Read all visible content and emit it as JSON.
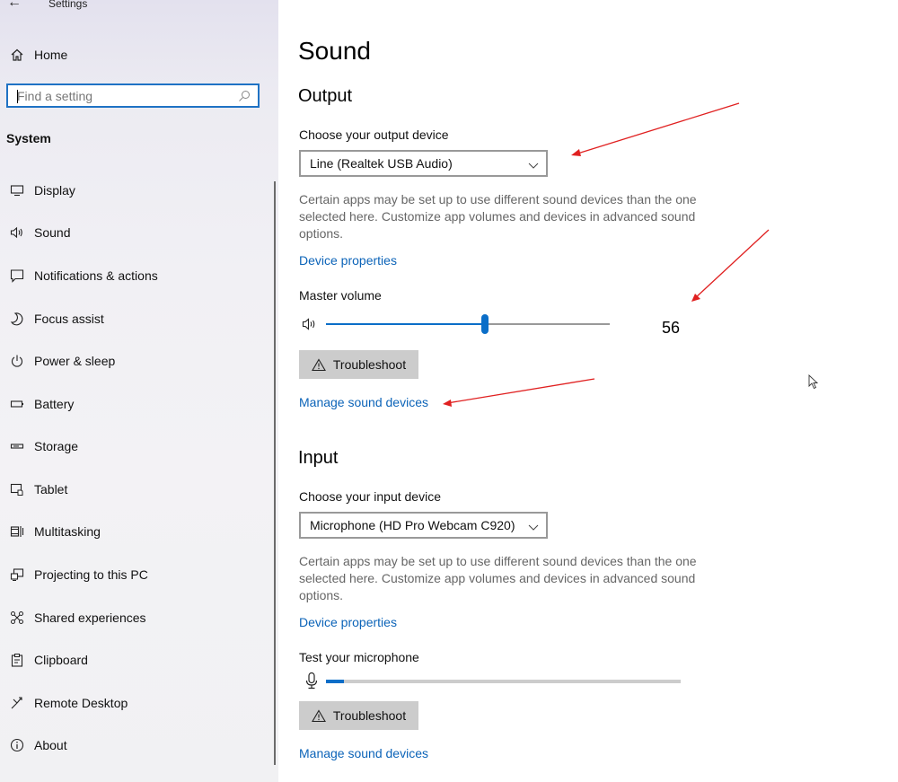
{
  "window": {
    "title": "Settings",
    "back_icon": "back-arrow-icon"
  },
  "sidebar": {
    "home_label": "Home",
    "search_placeholder": "Find a setting",
    "section_title": "System",
    "items": [
      {
        "label": "Display",
        "icon": "display-icon"
      },
      {
        "label": "Sound",
        "icon": "speaker-icon"
      },
      {
        "label": "Notifications & actions",
        "icon": "notifications-icon"
      },
      {
        "label": "Focus assist",
        "icon": "moon-icon"
      },
      {
        "label": "Power & sleep",
        "icon": "power-icon"
      },
      {
        "label": "Battery",
        "icon": "battery-icon"
      },
      {
        "label": "Storage",
        "icon": "storage-icon"
      },
      {
        "label": "Tablet",
        "icon": "tablet-icon"
      },
      {
        "label": "Multitasking",
        "icon": "multitasking-icon"
      },
      {
        "label": "Projecting to this PC",
        "icon": "projecting-icon"
      },
      {
        "label": "Shared experiences",
        "icon": "shared-experiences-icon"
      },
      {
        "label": "Clipboard",
        "icon": "clipboard-icon"
      },
      {
        "label": "Remote Desktop",
        "icon": "remote-desktop-icon"
      },
      {
        "label": "About",
        "icon": "info-icon"
      }
    ]
  },
  "main": {
    "title": "Sound",
    "output": {
      "heading": "Output",
      "device_label": "Choose your output device",
      "device_value": "Line (Realtek USB Audio)",
      "description": "Certain apps may be set up to use different sound devices than the one selected here. Customize app volumes and devices in advanced sound options.",
      "device_properties_link": "Device properties",
      "master_volume_label": "Master volume",
      "volume_value": "56",
      "troubleshoot_label": "Troubleshoot",
      "manage_link": "Manage sound devices"
    },
    "input": {
      "heading": "Input",
      "device_label": "Choose your input device",
      "device_value": "Microphone (HD Pro Webcam C920)",
      "description": "Certain apps may be set up to use different sound devices than the one selected here. Customize app volumes and devices in advanced sound options.",
      "device_properties_link": "Device properties",
      "test_label": "Test your microphone",
      "mic_level_fraction": 0.05,
      "troubleshoot_label": "Troubleshoot",
      "manage_link": "Manage sound devices"
    }
  },
  "colors": {
    "accent": "#0b6ec8",
    "link": "#0b63b8",
    "annotation_arrow": "#e02020"
  }
}
